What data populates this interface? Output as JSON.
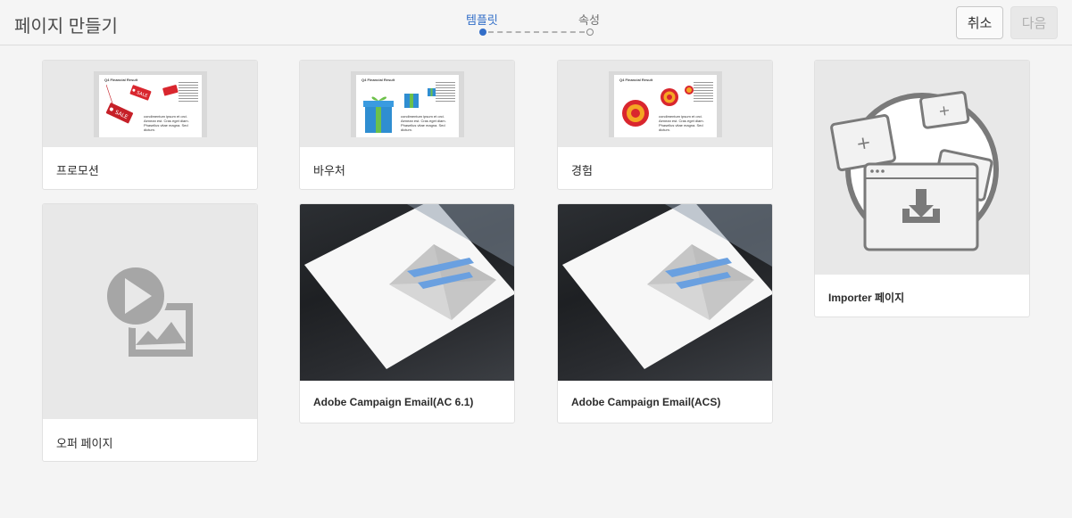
{
  "header": {
    "title": "페이지 만들기",
    "steps": [
      {
        "label": "템플릿",
        "active": true
      },
      {
        "label": "속성",
        "active": false
      }
    ],
    "cancel_label": "취소",
    "next_label": "다음"
  },
  "templates": [
    {
      "title": "프로모션",
      "thumb": "promotion-doc",
      "doc_header": "Q4 Financial Result",
      "doc_text": "condimentum ipsum et orci. Aenean est. Cras eget diam. Phasellus vitae magna. Sed dictum.",
      "badge_text": "SALE"
    },
    {
      "title": "바우처",
      "thumb": "voucher-doc",
      "doc_header": "Q4 Financial Result",
      "doc_text": "condimentum ipsum et orci. Aenean est. Cras eget diam. Phasellus vitae magna. Sed dictum."
    },
    {
      "title": "경험",
      "thumb": "experience-doc",
      "doc_header": "Q4 Financial Result",
      "doc_text": "condimentum ipsum et orci. Aenean est. Cras eget diam. Phasellus vitae magna. Sed dictum."
    },
    {
      "title": "Importer 페이지",
      "thumb": "importer-icon"
    },
    {
      "title": "오퍼 페이지",
      "thumb": "offer-icon"
    },
    {
      "title": "Adobe Campaign Email(AC 6.1)",
      "thumb": "email-photo"
    },
    {
      "title": "Adobe Campaign Email(ACS)",
      "thumb": "email-photo"
    }
  ],
  "colors": {
    "accent": "#326ec8",
    "background": "#f4f4f4"
  }
}
